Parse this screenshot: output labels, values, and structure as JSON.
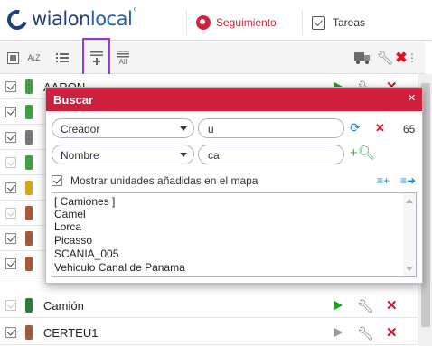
{
  "header": {
    "logo_bold": "wialon",
    "logo_light": "local",
    "logo_mark": "°",
    "tabs": [
      {
        "label": "Seguimiento",
        "icon": "globe-icon",
        "color": "#d0223a"
      },
      {
        "label": "Tareas",
        "icon": "tasks-checkbox-icon"
      }
    ]
  },
  "toolbar": {
    "sort_label": "A↓Z",
    "all_label": "All",
    "more_label": "⋮"
  },
  "units": [
    {
      "name": "AARON",
      "checked": true,
      "icon_color": "#3fa03f",
      "play": "green"
    },
    {
      "name": "",
      "checked": true,
      "icon_color": "#3fa03f",
      "play": "green"
    },
    {
      "name": "",
      "checked": true,
      "icon_color": "#777777",
      "play": "green"
    },
    {
      "name": "",
      "checked": true,
      "dim": true,
      "icon_color": "#3fa03f",
      "play": "green"
    },
    {
      "name": "",
      "checked": true,
      "icon_color": "#d8a21a",
      "play": "green"
    },
    {
      "name": "",
      "checked": true,
      "dim": true,
      "icon_color": "#a8583a",
      "play": "green"
    },
    {
      "name": "",
      "checked": true,
      "icon_color": "#a8583a",
      "play": "green"
    },
    {
      "name": "",
      "checked": true,
      "icon_color": "#a8583a",
      "play": "green"
    },
    {
      "name": "Camión",
      "checked": true,
      "dim": true,
      "icon_color": "#2e7d32",
      "play": "green"
    },
    {
      "name": "CERTEU1",
      "checked": true,
      "icon_color": "#a8583a",
      "play": "grey"
    }
  ],
  "dialog": {
    "title": "Buscar",
    "close": "×",
    "filter1": {
      "field": "Creador",
      "value": "u",
      "count": "65"
    },
    "filter2": {
      "field": "Nombre",
      "value": "ca"
    },
    "show_on_map_label": "Mostrar unidades añadidas en el mapa",
    "results": [
      "[ Camiones ]",
      "Camel",
      "Lorca",
      "Picasso",
      "SCANIA_005",
      "Vehiculo Canal de Panama"
    ]
  },
  "colors": {
    "accent": "#d01f3c",
    "highlight": "#9a36e0",
    "green": "#22a022",
    "red": "#e01020"
  }
}
